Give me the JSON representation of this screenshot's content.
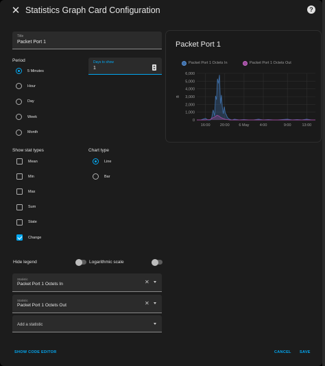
{
  "header": {
    "title": "Statistics Graph Card Configuration",
    "close_icon": "close-icon",
    "help_icon": "help-icon"
  },
  "title_field": {
    "label": "Title",
    "value": "Packet Port 1"
  },
  "period": {
    "label": "Period",
    "options": [
      {
        "label": "5 Minutes",
        "checked": true
      },
      {
        "label": "Hour",
        "checked": false
      },
      {
        "label": "Day",
        "checked": false
      },
      {
        "label": "Week",
        "checked": false
      },
      {
        "label": "Month",
        "checked": false
      }
    ]
  },
  "days_field": {
    "label": "Days to show",
    "value": "1"
  },
  "stat_types": {
    "label": "Show stat types",
    "options": [
      {
        "label": "Mean",
        "checked": false
      },
      {
        "label": "Min",
        "checked": false
      },
      {
        "label": "Max",
        "checked": false
      },
      {
        "label": "Sum",
        "checked": false
      },
      {
        "label": "State",
        "checked": false
      },
      {
        "label": "Change",
        "checked": true
      }
    ]
  },
  "chart_type": {
    "label": "Chart type",
    "options": [
      {
        "label": "Line",
        "checked": true
      },
      {
        "label": "Bar",
        "checked": false
      }
    ]
  },
  "toggles": {
    "hide_legend": "Hide legend",
    "logarithmic": "Logarithmic scale"
  },
  "statistics": [
    {
      "label": "Statistic",
      "value": "Packet Port 1 Octets In"
    },
    {
      "label": "Statistic",
      "value": "Packet Port 1 Octets Out"
    }
  ],
  "add_statistic": "Add a statistic",
  "footer": {
    "show_code": "SHOW CODE EDITOR",
    "cancel": "CANCEL",
    "save": "SAVE"
  },
  "colors": {
    "accent": "#03a9f4",
    "series_in": "#3e6fa8",
    "series_out": "#9c4a9c"
  },
  "preview": {
    "title": "Packet Port 1"
  },
  "chart_data": {
    "type": "line",
    "ylabel": "B",
    "ylim": [
      0,
      6000
    ],
    "yticks": [
      "6,000",
      "5,000",
      "4,000",
      "3,000",
      "2,000",
      "1,000",
      "0"
    ],
    "ytick_values": [
      6000,
      5000,
      4000,
      3000,
      2000,
      1000,
      0
    ],
    "xticks": [
      "16:00",
      "20:00",
      "6 May",
      "4:00",
      "9:00",
      "13:00"
    ],
    "xtick_hours": [
      16,
      20,
      24,
      28,
      33,
      37
    ],
    "xlim_hours": [
      14.2,
      38.8
    ],
    "grid": true,
    "legend_position": "top",
    "series": [
      {
        "name": "Packet Port 1 Octets In",
        "x": [
          14.2,
          15.0,
          16.0,
          16.5,
          17.0,
          17.3,
          17.6,
          17.9,
          18.1,
          18.3,
          18.5,
          18.7,
          18.9,
          19.1,
          19.3,
          19.5,
          19.7,
          19.9,
          20.1,
          20.3,
          20.5,
          20.7,
          21.0,
          21.5,
          22.0,
          23.0,
          24.0,
          25.0,
          26.0,
          27.0,
          28.0,
          29.0,
          30.0,
          31.0,
          32.0,
          33.0,
          34.0,
          35.0,
          36.0,
          37.0,
          38.0,
          38.8
        ],
        "y": [
          0,
          0,
          200,
          0,
          0,
          300,
          1300,
          500,
          3100,
          2600,
          5300,
          4700,
          5800,
          2100,
          3200,
          1600,
          800,
          1700,
          900,
          700,
          400,
          200,
          100,
          0,
          100,
          0,
          50,
          0,
          0,
          100,
          0,
          50,
          0,
          0,
          50,
          100,
          0,
          50,
          0,
          100,
          0,
          0
        ]
      },
      {
        "name": "Packet Port 1 Octets Out",
        "x": [
          14.2,
          16.0,
          17.0,
          17.3,
          17.6,
          18.0,
          18.4,
          18.8,
          19.2,
          19.6,
          20.0,
          20.5,
          21.0,
          22.0,
          24.0,
          28.0,
          32.0,
          36.0,
          38.8
        ],
        "y": [
          0,
          0,
          50,
          200,
          300,
          400,
          600,
          500,
          300,
          200,
          100,
          50,
          0,
          0,
          0,
          0,
          0,
          0,
          0
        ]
      }
    ]
  }
}
